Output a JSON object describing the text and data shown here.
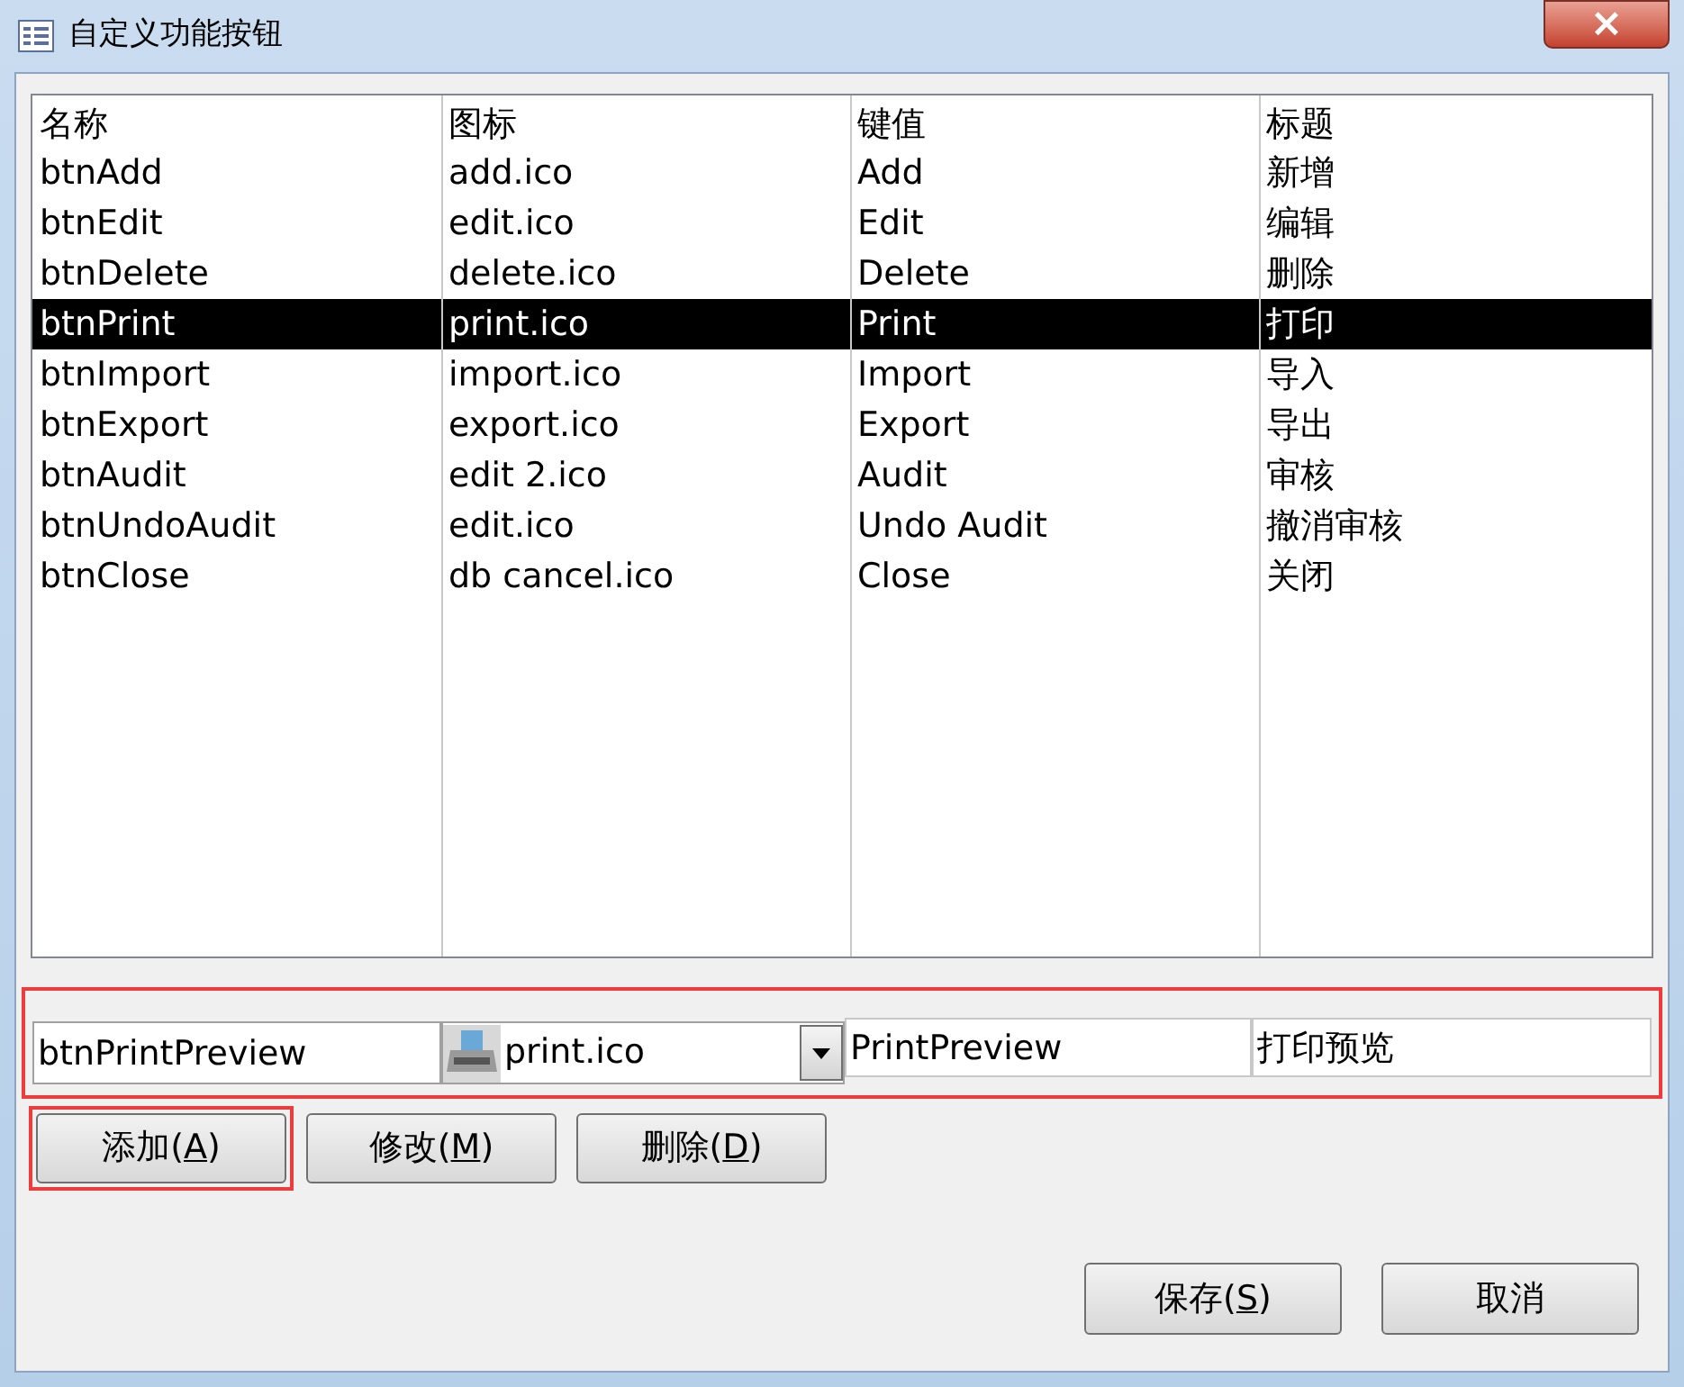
{
  "window": {
    "title": "自定义功能按钮",
    "close": "×"
  },
  "table": {
    "columns": [
      "名称",
      "图标",
      "键值",
      "标题"
    ],
    "rows": [
      {
        "cells": [
          "btnAdd",
          "add.ico",
          "Add",
          "新增"
        ],
        "selected": false
      },
      {
        "cells": [
          "btnEdit",
          "edit.ico",
          "Edit",
          "编辑"
        ],
        "selected": false
      },
      {
        "cells": [
          "btnDelete",
          "delete.ico",
          "Delete",
          "删除"
        ],
        "selected": false
      },
      {
        "cells": [
          "btnPrint",
          "print.ico",
          "Print",
          "打印"
        ],
        "selected": true
      },
      {
        "cells": [
          "btnImport",
          "import.ico",
          "Import",
          "导入"
        ],
        "selected": false
      },
      {
        "cells": [
          "btnExport",
          "export.ico",
          "Export",
          "导出"
        ],
        "selected": false
      },
      {
        "cells": [
          "btnAudit",
          "edit 2.ico",
          "Audit",
          "审核"
        ],
        "selected": false
      },
      {
        "cells": [
          "btnUndoAudit",
          "edit.ico",
          "Undo Audit",
          "撤消审核"
        ],
        "selected": false
      },
      {
        "cells": [
          "btnClose",
          "db cancel.ico",
          "Close",
          "关闭"
        ],
        "selected": false
      }
    ]
  },
  "editor": {
    "highlighted": true,
    "name": "btnPrintPreview",
    "icon": "print.ico",
    "key": "PrintPreview",
    "caption": "打印预览"
  },
  "row_buttons": [
    {
      "before": "添加(",
      "mnemonic": "A",
      "after": ")",
      "highlighted": true
    },
    {
      "before": "修改(",
      "mnemonic": "M",
      "after": ")",
      "highlighted": false
    },
    {
      "before": "删除(",
      "mnemonic": "D",
      "after": ")",
      "highlighted": false
    }
  ],
  "footer_buttons": [
    {
      "before": "保存(",
      "mnemonic": "S",
      "after": ")"
    },
    {
      "before": "取消"
    }
  ]
}
